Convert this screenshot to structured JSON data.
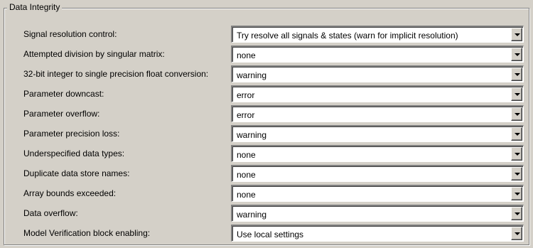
{
  "group": {
    "title": "Data Integrity"
  },
  "icons": {
    "dropdown": "chevron-down-icon"
  },
  "rows": [
    {
      "label": "Signal resolution control:",
      "value": "Try resolve all signals & states (warn for implicit resolution)"
    },
    {
      "label": "Attempted division by singular matrix:",
      "value": "none"
    },
    {
      "label": "32-bit integer to single precision float conversion:",
      "value": "warning"
    },
    {
      "label": "Parameter downcast:",
      "value": "error"
    },
    {
      "label": "Parameter overflow:",
      "value": "error"
    },
    {
      "label": "Parameter precision loss:",
      "value": "warning"
    },
    {
      "label": "Underspecified data types:",
      "value": "none"
    },
    {
      "label": "Duplicate data store names:",
      "value": "none"
    },
    {
      "label": "Array bounds exceeded:",
      "value": "none"
    },
    {
      "label": "Data overflow:",
      "value": "warning"
    },
    {
      "label": "Model Verification block enabling:",
      "value": "Use local settings"
    }
  ]
}
